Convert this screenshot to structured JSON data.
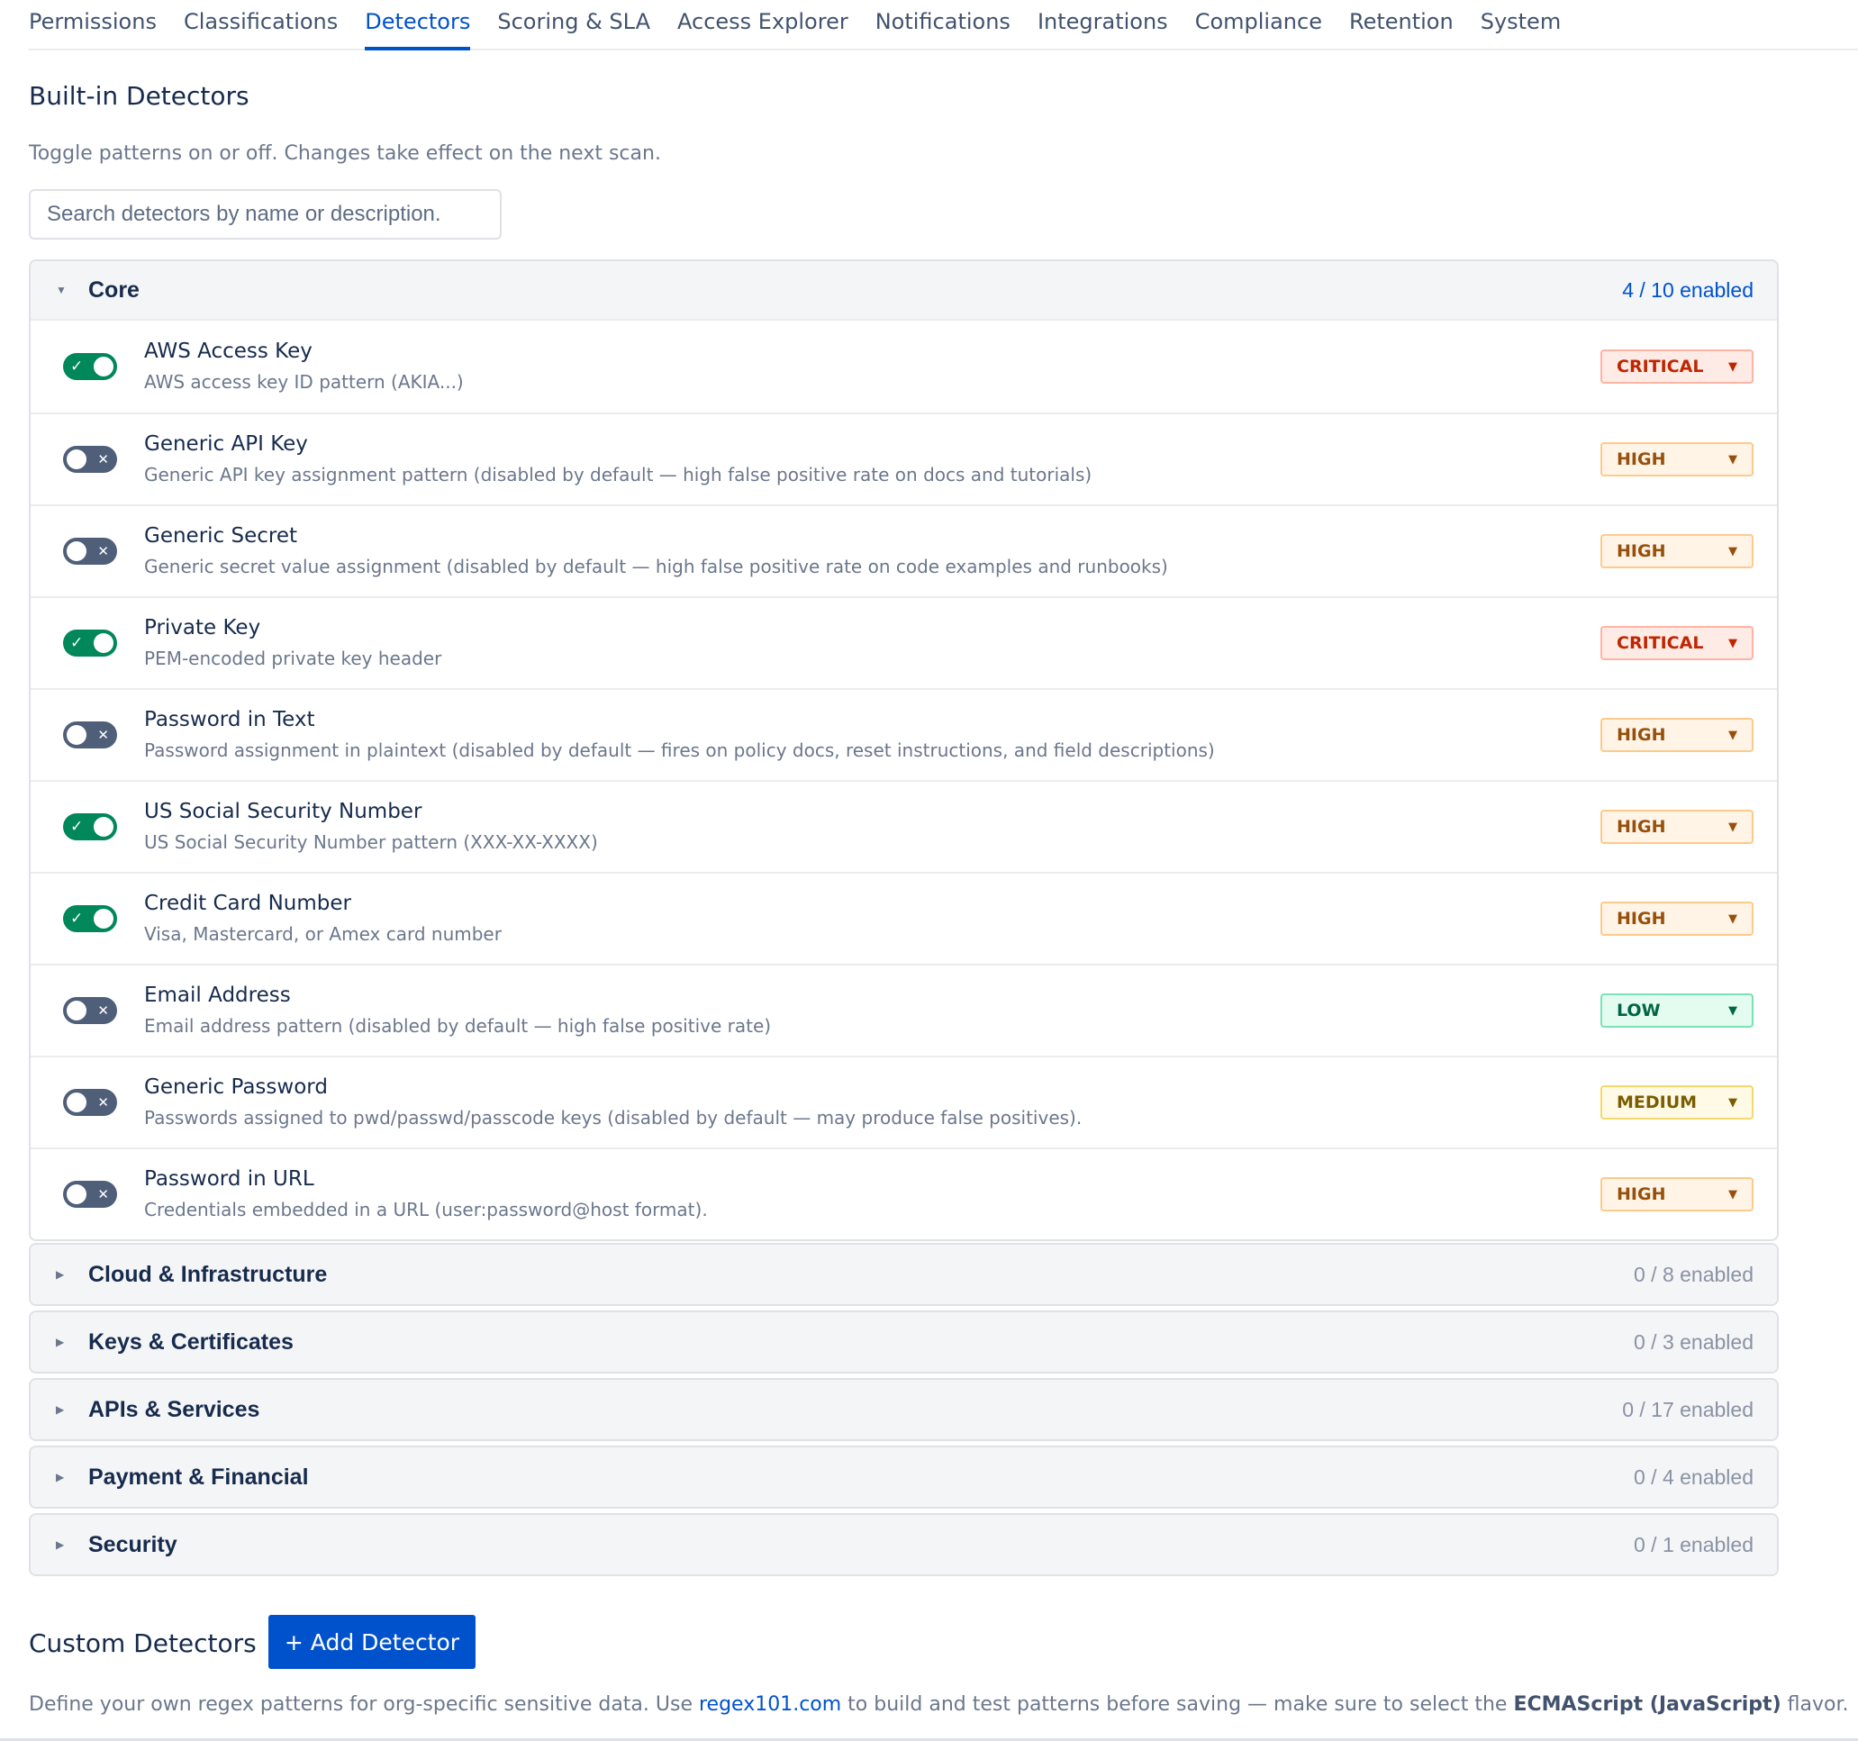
{
  "tabs": [
    "Permissions",
    "Classifications",
    "Detectors",
    "Scoring & SLA",
    "Access Explorer",
    "Notifications",
    "Integrations",
    "Compliance",
    "Retention",
    "System"
  ],
  "active_tab": "Detectors",
  "builtin": {
    "title": "Built-in Detectors",
    "subtitle": "Toggle patterns on or off. Changes take effect on the next scan.",
    "search_placeholder": "Search detectors by name or description."
  },
  "groups": [
    {
      "name": "Core",
      "count": "4 / 10 enabled",
      "expanded": true,
      "detectors": [
        {
          "name": "AWS Access Key",
          "description": "AWS access key ID pattern (AKIA...)",
          "enabled": true,
          "severity": "CRITICAL"
        },
        {
          "name": "Generic API Key",
          "description": "Generic API key assignment pattern (disabled by default — high false positive rate on docs and tutorials)",
          "enabled": false,
          "severity": "HIGH"
        },
        {
          "name": "Generic Secret",
          "description": "Generic secret value assignment (disabled by default — high false positive rate on code examples and runbooks)",
          "enabled": false,
          "severity": "HIGH"
        },
        {
          "name": "Private Key",
          "description": "PEM-encoded private key header",
          "enabled": true,
          "severity": "CRITICAL"
        },
        {
          "name": "Password in Text",
          "description": "Password assignment in plaintext (disabled by default — fires on policy docs, reset instructions, and field descriptions)",
          "enabled": false,
          "severity": "HIGH"
        },
        {
          "name": "US Social Security Number",
          "description": "US Social Security Number pattern (XXX-XX-XXXX)",
          "enabled": true,
          "severity": "HIGH"
        },
        {
          "name": "Credit Card Number",
          "description": "Visa, Mastercard, or Amex card number",
          "enabled": true,
          "severity": "HIGH"
        },
        {
          "name": "Email Address",
          "description": "Email address pattern (disabled by default — high false positive rate)",
          "enabled": false,
          "severity": "LOW"
        },
        {
          "name": "Generic Password",
          "description": "Passwords assigned to pwd/passwd/passcode keys (disabled by default — may produce false positives).",
          "enabled": false,
          "severity": "MEDIUM"
        },
        {
          "name": "Password in URL",
          "description": "Credentials embedded in a URL (user:password@host format).",
          "enabled": false,
          "severity": "HIGH"
        }
      ]
    },
    {
      "name": "Cloud & Infrastructure",
      "count": "0 / 8 enabled",
      "expanded": false
    },
    {
      "name": "Keys & Certificates",
      "count": "0 / 3 enabled",
      "expanded": false
    },
    {
      "name": "APIs & Services",
      "count": "0 / 17 enabled",
      "expanded": false
    },
    {
      "name": "Payment & Financial",
      "count": "0 / 4 enabled",
      "expanded": false
    },
    {
      "name": "Security",
      "count": "0 / 1 enabled",
      "expanded": false
    }
  ],
  "custom": {
    "title": "Custom Detectors",
    "add_button": "+ Add Detector",
    "desc_before": "Define your own regex patterns for org-specific sensitive data. Use ",
    "link": "regex101.com",
    "desc_middle": " to build and test patterns before saving — make sure to select the ",
    "desc_bold": "ECMAScript (JavaScript)",
    "desc_after": " flavor."
  },
  "icons": {
    "expanded": "caret-down-icon",
    "collapsed": "caret-right-icon",
    "toggle_on": "check-icon",
    "toggle_off": "x-icon",
    "dropdown": "dropdown-arrow-icon"
  },
  "colors": {
    "accent": "#0052cc",
    "toggle_on": "#00875a",
    "toggle_off": "#505f79"
  }
}
